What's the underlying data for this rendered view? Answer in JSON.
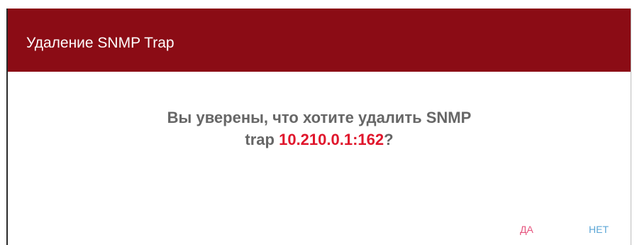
{
  "dialog": {
    "title": "Удаление SNMP Trap",
    "message_line1": "Вы уверены, что хотите удалить SNMP",
    "message_prefix": "trap",
    "target": "10.210.0.1:162",
    "message_suffix": "?",
    "yes_label": "ДА",
    "no_label": "НЕТ"
  },
  "colors": {
    "header": "#8b0c15",
    "target": "#e0162c",
    "yes": "#e6547e",
    "no": "#5ba6d6"
  }
}
